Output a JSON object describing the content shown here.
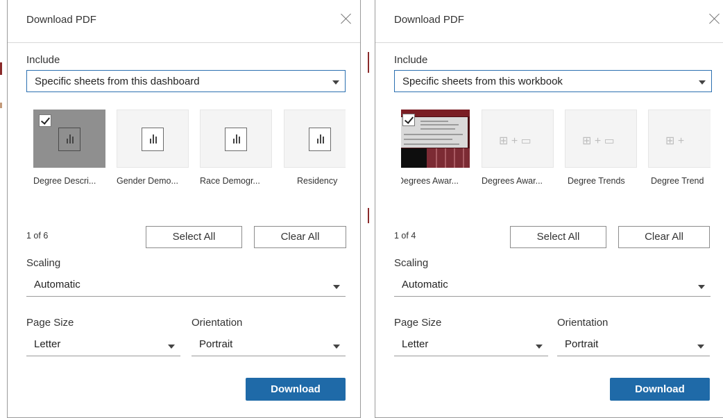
{
  "accent_color": "#1f6aa8",
  "dialogs": [
    {
      "title": "Download PDF",
      "include_label": "Include",
      "include_value": "Specific sheets from this dashboard",
      "sheets": [
        {
          "name": "Degree Descri...",
          "selected": true,
          "icon": "bar-chart-icon"
        },
        {
          "name": "Gender Demo...",
          "selected": false,
          "icon": "bar-chart-icon"
        },
        {
          "name": "Race Demogr...",
          "selected": false,
          "icon": "bar-chart-icon"
        },
        {
          "name": "Residency",
          "selected": false,
          "icon": "bar-chart-icon"
        }
      ],
      "count": "1 of 6",
      "select_all": "Select All",
      "clear_all": "Clear All",
      "scaling_label": "Scaling",
      "scaling_value": "Automatic",
      "page_size_label": "Page Size",
      "page_size_value": "Letter",
      "orientation_label": "Orientation",
      "orientation_value": "Portrait",
      "download": "Download"
    },
    {
      "title": "Download PDF",
      "include_label": "Include",
      "include_value": "Specific sheets from this workbook",
      "sheets": [
        {
          "name": "Degrees Awar...",
          "selected": true,
          "icon": "dashboard-thumbnail"
        },
        {
          "name": "Degrees Awar...",
          "selected": false,
          "icon": "dashboard-placeholder-icon"
        },
        {
          "name": "Degree Trends",
          "selected": false,
          "icon": "dashboard-placeholder-icon"
        },
        {
          "name": "Degree Trend",
          "selected": false,
          "icon": "dashboard-placeholder-icon"
        }
      ],
      "count": "1 of 4",
      "select_all": "Select All",
      "clear_all": "Clear All",
      "scaling_label": "Scaling",
      "scaling_value": "Automatic",
      "page_size_label": "Page Size",
      "page_size_value": "Letter",
      "orientation_label": "Orientation",
      "orientation_value": "Portrait",
      "download": "Download"
    }
  ]
}
